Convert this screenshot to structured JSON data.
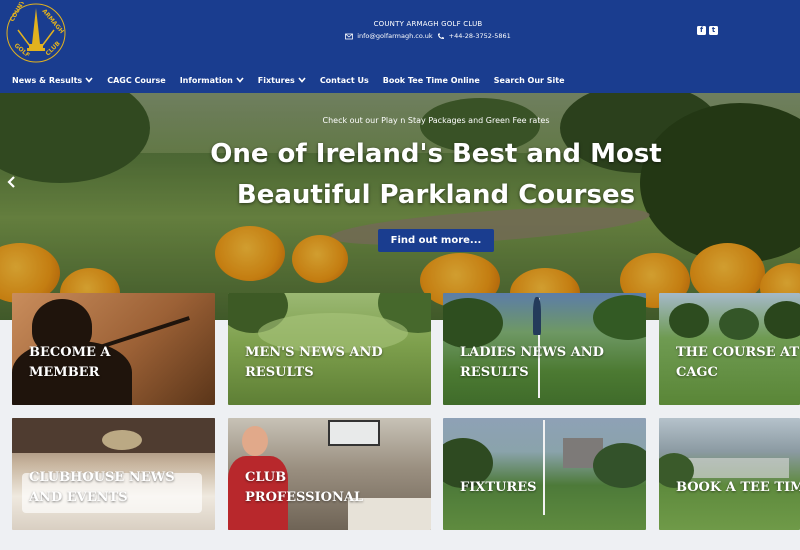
{
  "header": {
    "logo_text": "COUNTY ARMAGH GOLF CLUB",
    "club_name": "COUNTY ARMAGH GOLF CLUB",
    "email": "info@golfarmagh.co.uk",
    "phone": "+44-28-3752-5861",
    "social": {
      "facebook": "f",
      "twitter": "t"
    }
  },
  "nav": [
    {
      "label": "News & Results",
      "dropdown": true
    },
    {
      "label": "CAGC Course",
      "dropdown": false
    },
    {
      "label": "Information",
      "dropdown": true
    },
    {
      "label": "Fixtures",
      "dropdown": true
    },
    {
      "label": "Contact Us",
      "dropdown": false
    },
    {
      "label": "Book Tee Time Online",
      "dropdown": false
    },
    {
      "label": "Search Our Site",
      "dropdown": false
    }
  ],
  "hero": {
    "subtitle": "Check out our Play n Stay Packages and Green Fee rates",
    "title_line1": "One of Ireland's Best and Most",
    "title_line2": "Beautiful Parkland Courses",
    "button": "Find out more..."
  },
  "tiles": [
    {
      "line1": "BECOME A",
      "line2": "MEMBER"
    },
    {
      "line1": "MEN'S NEWS AND",
      "line2": "RESULTS"
    },
    {
      "line1": "LADIES NEWS AND",
      "line2": "RESULTS"
    },
    {
      "line1": "THE COURSE AT",
      "line2": "CAGC"
    },
    {
      "line1": "CLUBHOUSE NEWS",
      "line2": "AND EVENTS"
    },
    {
      "line1": "CLUB",
      "line2": "PROFESSIONAL"
    },
    {
      "line1": "FIXTURES",
      "line2": ""
    },
    {
      "line1": "BOOK A TEE TIME",
      "line2": ""
    }
  ],
  "colors": {
    "brand_blue": "#1a3d8f",
    "logo_gold": "#e2b21f",
    "page_bg": "#eef0f3"
  }
}
